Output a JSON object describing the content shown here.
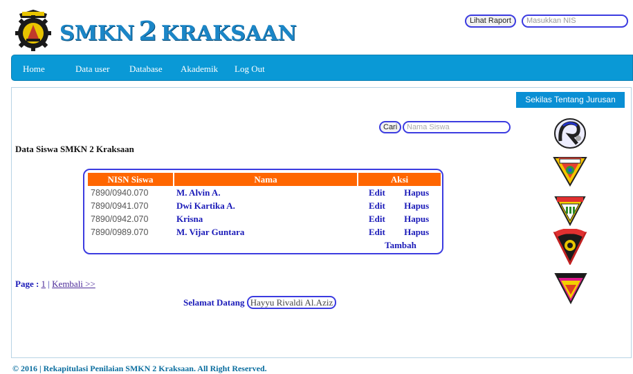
{
  "header": {
    "site_title_prefix": "SMKN",
    "site_title_number": "2",
    "site_title_suffix": "KRAKSAAN",
    "raport_button": "Lihat Raport",
    "nis_placeholder": "Masukkan NIS"
  },
  "nav": {
    "items": [
      {
        "label": "Home"
      },
      {
        "label": "Data user"
      },
      {
        "label": "Database"
      },
      {
        "label": "Akademik"
      },
      {
        "label": "Log Out"
      }
    ]
  },
  "sidebar": {
    "button_label": "Sekilas Tentang Jurusan",
    "logos": [
      {
        "icon": "rpl-logo-icon"
      },
      {
        "icon": "tkj-shield-icon"
      },
      {
        "icon": "electrical-shield-icon"
      },
      {
        "icon": "mesin-shield-icon"
      },
      {
        "icon": "tata-busana-shield-icon"
      }
    ]
  },
  "search": {
    "button_label": "Cari",
    "placeholder": "Nama Siswa"
  },
  "main": {
    "title": "Data Siswa SMKN 2 Kraksaan",
    "table": {
      "headers": [
        "NISN Siswa",
        "Nama",
        "Aksi"
      ],
      "rows": [
        {
          "nisn": "7890/0940.070",
          "nama": "M. Alvin A.",
          "edit": "Edit",
          "hapus": "Hapus"
        },
        {
          "nisn": "7890/0941.070",
          "nama": "Dwi Kartika A.",
          "edit": "Edit",
          "hapus": "Hapus"
        },
        {
          "nisn": "7890/0942.070",
          "nama": "Krisna",
          "edit": "Edit",
          "hapus": "Hapus"
        },
        {
          "nisn": "7890/0989.070",
          "nama": "M. Vijar Guntara",
          "edit": "Edit",
          "hapus": "Hapus"
        }
      ],
      "add_label": "Tambah"
    },
    "pagination": {
      "label": "Page :",
      "page": "1",
      "separator": "|",
      "back_label": "Kembali >>"
    },
    "welcome": {
      "label": "Selamat Datang",
      "user": "Hayyu Rivaldi Al.Aziz"
    }
  },
  "footer": {
    "text": "© 2016 | Rekapitulasi Penilaian SMKN 2 Kraksaan. All Right Reserved."
  },
  "colors": {
    "nav_bg": "#0a99d6",
    "table_header": "#ff6600",
    "link": "#1a1ab8",
    "accent_border": "#3b3be0"
  }
}
